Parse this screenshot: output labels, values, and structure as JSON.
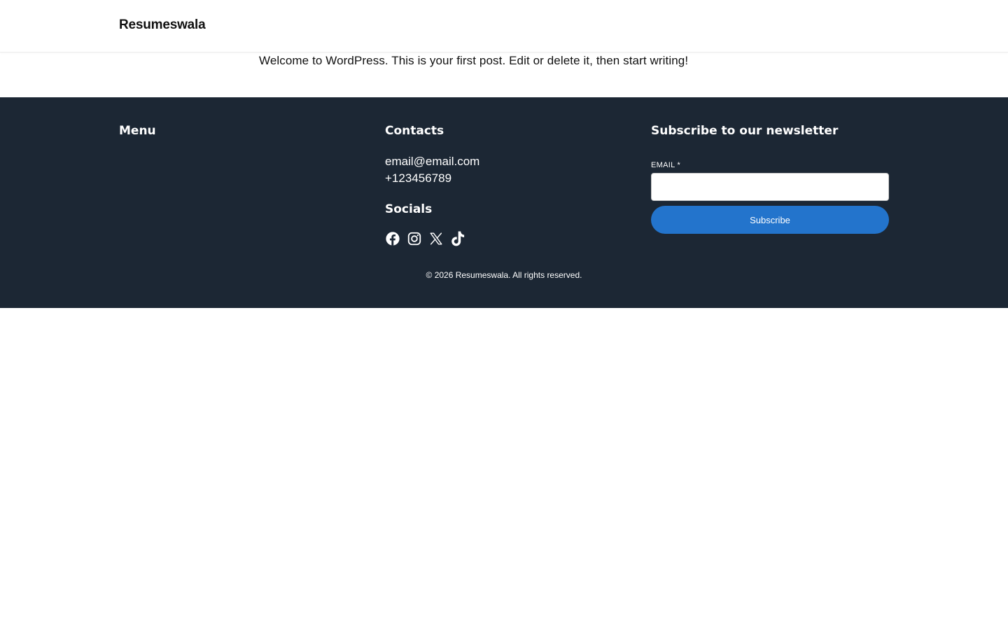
{
  "header": {
    "site_title": "Resumeswala"
  },
  "post": {
    "excerpt": "Welcome to WordPress. This is your first post. Edit or delete it, then start writing!"
  },
  "footer": {
    "menu": {
      "heading": "Menu"
    },
    "contacts": {
      "heading": "Contacts",
      "email": "email@email.com",
      "phone": "+123456789"
    },
    "socials": {
      "heading": "Socials",
      "icons": [
        "facebook-icon",
        "instagram-icon",
        "x-icon",
        "tiktok-icon"
      ]
    },
    "newsletter": {
      "heading": "Subscribe to our newsletter",
      "email_label": "EMAIL *",
      "email_value": "",
      "subscribe_label": "Subscribe"
    },
    "copyright": "© 2026 Resumeswala. All rights reserved."
  },
  "colors": {
    "footer_bg": "#1c2734",
    "button_bg": "#2374cc",
    "text_dark": "#111111",
    "text_light": "#ffffff"
  }
}
